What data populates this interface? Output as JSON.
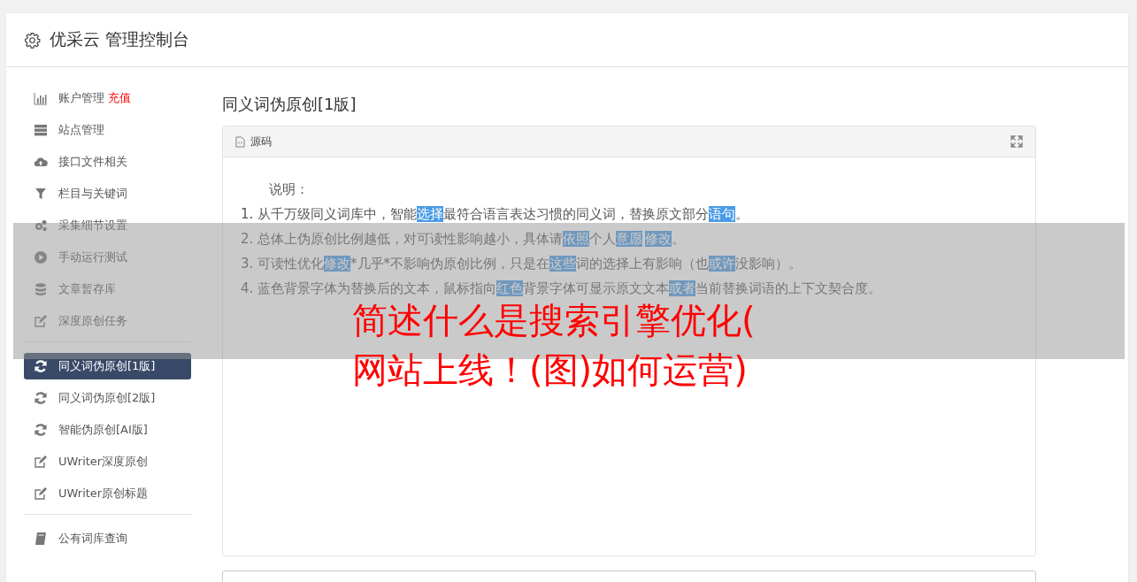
{
  "header": {
    "title": "优采云 管理控制台"
  },
  "sidebar": {
    "groups": [
      {
        "items": [
          {
            "label": "账户管理",
            "badge": "充值",
            "selected": false
          },
          {
            "label": "站点管理",
            "selected": false
          },
          {
            "label": "接口文件相关",
            "selected": false
          },
          {
            "label": "栏目与关键词",
            "selected": false
          },
          {
            "label": "采集细节设置",
            "selected": false
          },
          {
            "label": "手动运行测试",
            "selected": false
          },
          {
            "label": "文章暂存库",
            "selected": false
          },
          {
            "label": "深度原创任务",
            "selected": false
          }
        ]
      },
      {
        "items": [
          {
            "label": "同义词伪原创[1版]",
            "selected": true
          },
          {
            "label": "同义词伪原创[2版]",
            "selected": false
          },
          {
            "label": "智能伪原创[AI版]",
            "selected": false
          },
          {
            "label": "UWriter深度原创",
            "selected": false
          },
          {
            "label": "UWriter原创标题",
            "selected": false
          }
        ]
      },
      {
        "items": [
          {
            "label": "公有词库查询",
            "selected": false
          }
        ]
      }
    ]
  },
  "main": {
    "title": "同义词伪原创[1版]",
    "panel": {
      "tab": "源码",
      "heading": "说明：",
      "lines": [
        [
          {
            "text": "1. 从千万级同义词库中，智能",
            "highlighted": false
          },
          {
            "text": "选择",
            "highlighted": true
          },
          {
            "text": "最符合语言表达习惯的同义词，替换原文部分",
            "highlighted": false
          },
          {
            "text": "语句",
            "highlighted": true
          },
          {
            "text": "。",
            "highlighted": false
          }
        ],
        [
          {
            "text": "2. 总体上伪原创比例越低，对可读性影响越小，具体请",
            "highlighted": false
          },
          {
            "text": "依照",
            "highlighted": true
          },
          {
            "text": "个人",
            "highlighted": false
          },
          {
            "text": "意愿",
            "highlighted": true
          },
          {
            "text": "修改",
            "highlighted": true
          },
          {
            "text": "。",
            "highlighted": false
          }
        ],
        [
          {
            "text": "3. 可读性优化",
            "highlighted": false
          },
          {
            "text": "修改",
            "highlighted": true
          },
          {
            "text": "*几乎*不影响伪原创比例，只是在",
            "highlighted": false
          },
          {
            "text": "这些",
            "highlighted": true
          },
          {
            "text": "词的选择上有影响（也",
            "highlighted": false
          },
          {
            "text": "或许",
            "highlighted": true
          },
          {
            "text": "没影响）。",
            "highlighted": false
          }
        ],
        [
          {
            "text": "4. 蓝色背景字体为替换后的文本，鼠标指向",
            "highlighted": false
          },
          {
            "text": "红色",
            "highlighted": true
          },
          {
            "text": "背景字体可显示原文文本",
            "highlighted": false
          },
          {
            "text": "或者",
            "highlighted": true
          },
          {
            "text": "当前替换词语的上下文契合度。",
            "highlighted": false
          }
        ]
      ]
    }
  },
  "overlay_banner": {
    "lines": [
      "简述什么是搜索引擎优化(",
      "网站上线！(图)如何运营)"
    ]
  }
}
